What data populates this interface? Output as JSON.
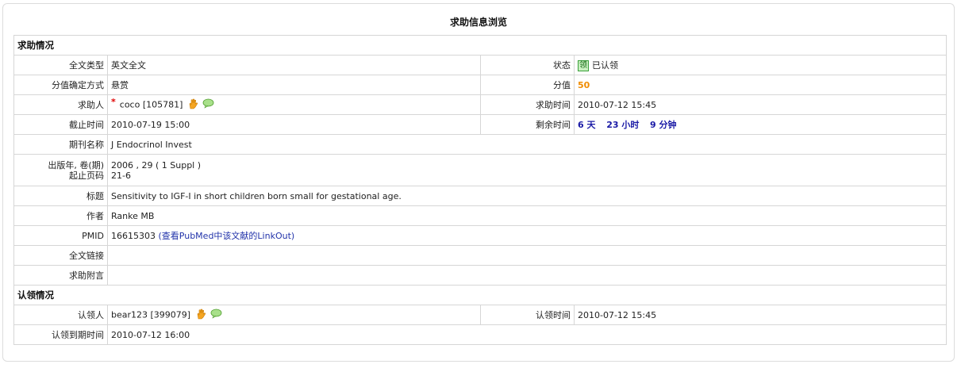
{
  "page_title": "求助信息浏览",
  "section_request": {
    "title": "求助情况",
    "fulltext_type_label": "全文类型",
    "fulltext_type_value": "英文全文",
    "status_label": "状态",
    "status_badge": "领",
    "status_value": "已认领",
    "points_method_label": "分值确定方式",
    "points_method_value": "悬赏",
    "points_label": "分值",
    "points_value": "50",
    "requester_label": "求助人",
    "requester_star": "*",
    "requester_value": "coco [105781]",
    "request_time_label": "求助时间",
    "request_time_value": "2010-07-12 15:45",
    "deadline_label": "截止时间",
    "deadline_value": "2010-07-19 15:00",
    "remaining_label": "剩余时间",
    "remaining_days": "6",
    "remaining_days_unit": "天",
    "remaining_hours": "23",
    "remaining_hours_unit": "小时",
    "remaining_minutes": "9",
    "remaining_minutes_unit": "分钟",
    "journal_label": "期刊名称",
    "journal_value": "J Endocrinol Invest",
    "pub_label_line1": "出版年, 卷(期)",
    "pub_label_line2": "起止页码",
    "pub_value_line1": "2006 , 29 ( 1 Suppl )",
    "pub_value_line2": "21-6",
    "title_label": "标题",
    "title_value": "Sensitivity to IGF-I in short children born small for gestational age.",
    "author_label": "作者",
    "author_value": "Ranke MB",
    "pmid_label": "PMID",
    "pmid_value": "16615303",
    "pmid_link": "(查看PubMed中该文献的LinkOut)",
    "fulltext_link_label": "全文链接",
    "fulltext_link_value": "",
    "note_label": "求助附言",
    "note_value": ""
  },
  "section_claim": {
    "title": "认领情况",
    "claimer_label": "认领人",
    "claimer_value": "bear123 [399079]",
    "claim_time_label": "认领时间",
    "claim_time_value": "2010-07-12 15:45",
    "claim_expire_label": "认领到期时间",
    "claim_expire_value": "2010-07-12 16:00"
  },
  "icons": {
    "hand": "hand-wave-icon",
    "message": "speech-bubble-icon"
  },
  "colors": {
    "points": "#f08c00",
    "remaining": "#1a1aa6",
    "link": "#2233aa",
    "star": "#e00000",
    "badge_bg": "#c9f0c0"
  }
}
